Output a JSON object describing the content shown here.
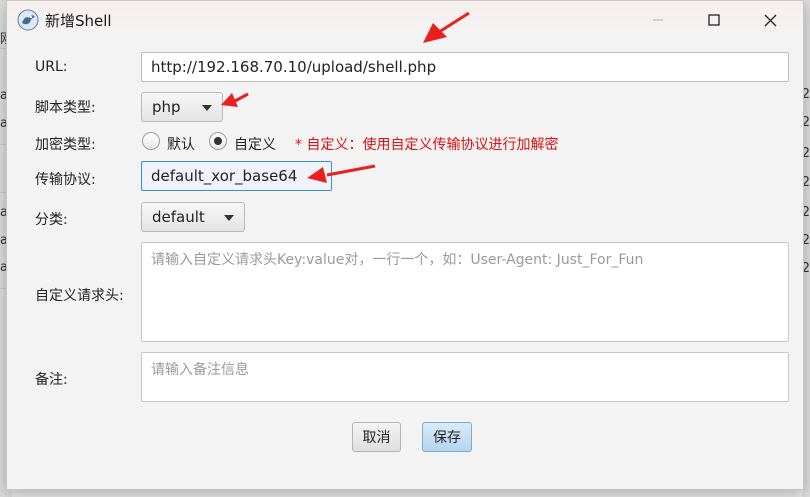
{
  "window": {
    "title": "新增Shell"
  },
  "form": {
    "url": {
      "label": "URL:",
      "value": "http://192.168.70.10/upload/shell.php"
    },
    "script_type": {
      "label": "脚本类型:",
      "value": "php"
    },
    "encryption": {
      "label": "加密类型:",
      "options": [
        "默认",
        "自定义"
      ],
      "selected": "自定义",
      "hint": "* 自定义：使用自定义传输协议进行加解密"
    },
    "protocol": {
      "label": "传输协议:",
      "value": "default_xor_base64"
    },
    "category": {
      "label": "分类:",
      "value": "default"
    },
    "headers": {
      "label": "自定义请求头:",
      "placeholder": "请输入自定义请求头Key:value对，一行一个，如：User-Agent: Just_For_Fun"
    },
    "remark": {
      "label": "备注:",
      "placeholder": "请输入备注信息"
    }
  },
  "buttons": {
    "cancel": "取消",
    "save": "保存"
  },
  "background": {
    "left_fragments": [
      "刚",
      "ati",
      "ati",
      "ati",
      "ati",
      "ati"
    ],
    "right_fragments": [
      "2",
      "2",
      "2",
      "2",
      "2",
      "2",
      "2"
    ]
  },
  "colors": {
    "hint": "#dd1111",
    "arrow": "#e8211f",
    "focus_border": "#3c8fd6",
    "save_button": "#b4d5ee"
  },
  "icons": {
    "app": "shell-logo-icon",
    "minimize": "minimize-icon",
    "maximize": "maximize-icon",
    "close": "close-icon"
  }
}
